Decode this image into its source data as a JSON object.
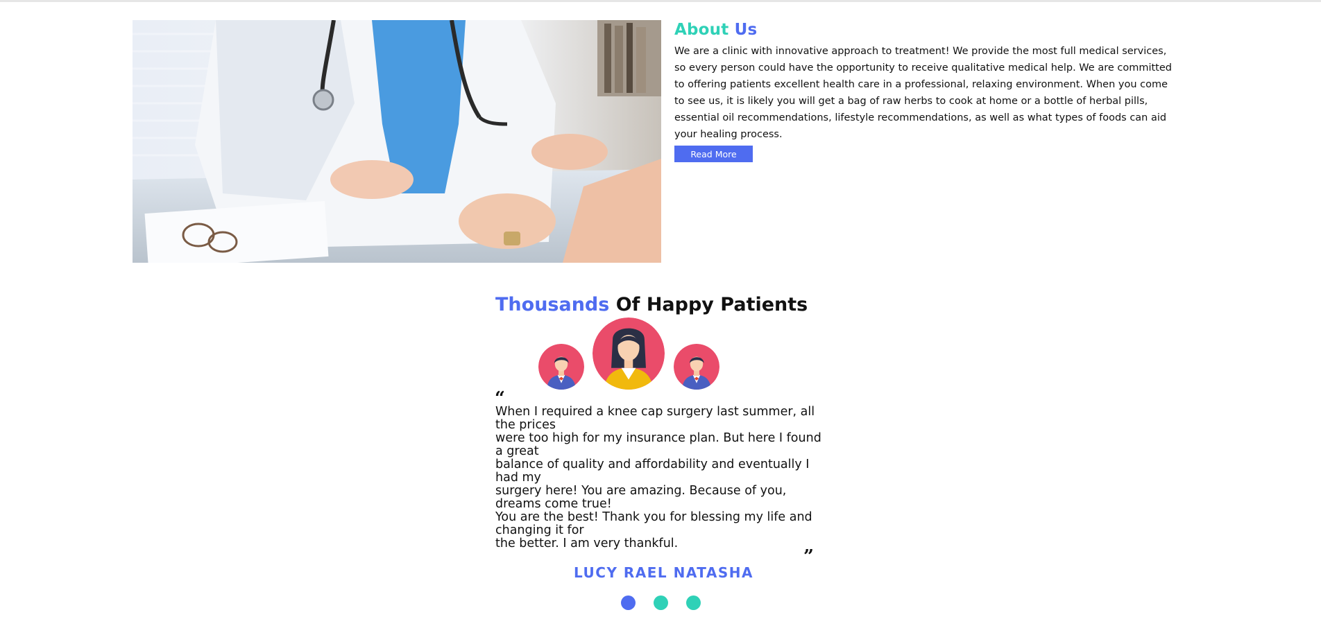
{
  "about": {
    "title_part1": "About",
    "title_part2": "Us",
    "body": "We are a clinic with innovative approach to treatment! We provide the most full medical services, so every person could have the opportunity to receive qualitative medical help. We are committed to offering patients excellent health care in a professional, relaxing environment. When you come to see us, it is likely you will get a bag of raw herbs to cook at home or a bottle of herbal pills, essential oil recommendations, lifestyle recommendations, as well as what types of foods can aid your healing process.",
    "read_more_label": "Read More"
  },
  "testimonials": {
    "title_highlight": "Thousands",
    "title_rest": " Of Happy Patients",
    "open_quote": "“",
    "close_quote": "”",
    "quote_lines": [
      "When I required a knee cap surgery last summer, all the prices",
      "were too high for my insurance plan. But here I found a great",
      "balance of quality and affordability and eventually I had my",
      "surgery here! You are amazing. Because of you, dreams come true!",
      "You are the best! Thank you for blessing my life and changing it for",
      "the better. I am very thankful."
    ],
    "author": "LUCY RAEL NATASHA"
  },
  "colors": {
    "teal": "#2fd1b7",
    "blue": "#4f6cf0",
    "avatar_bg": "#ea4c6a"
  },
  "icons": {
    "left_avatar": "male-patient-avatar-icon",
    "middle_avatar": "female-patient-avatar-icon",
    "right_avatar": "male-patient-avatar-icon"
  }
}
